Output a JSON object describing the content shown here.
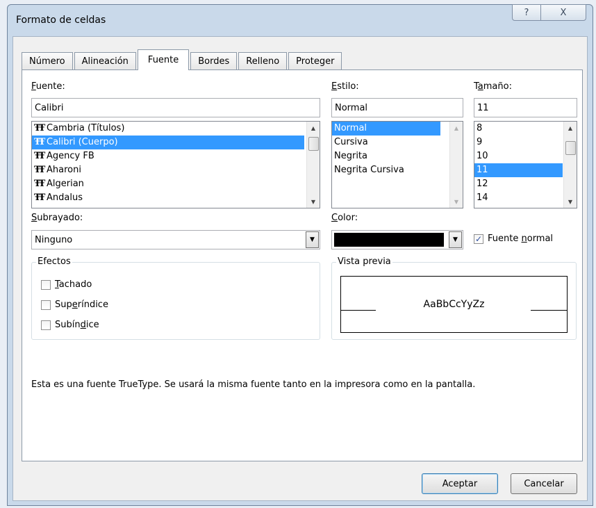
{
  "window": {
    "title": "Formato de celdas",
    "help_glyph": "?",
    "close_glyph": "X"
  },
  "tabs": [
    {
      "label": "Número"
    },
    {
      "label": "Alineación"
    },
    {
      "label": "Fuente"
    },
    {
      "label": "Bordes"
    },
    {
      "label": "Relleno"
    },
    {
      "label": "Proteger"
    }
  ],
  "font": {
    "label_underlined": "F",
    "label_rest": "uente:",
    "value": "Calibri",
    "items": [
      {
        "label": "Cambria (Títulos)",
        "selected": false
      },
      {
        "label": "Calibri (Cuerpo)",
        "selected": true
      },
      {
        "label": "Agency FB",
        "selected": false
      },
      {
        "label": "Aharoni",
        "selected": false
      },
      {
        "label": "Algerian",
        "selected": false
      },
      {
        "label": "Andalus",
        "selected": false
      }
    ]
  },
  "style": {
    "label_underlined": "E",
    "label_rest": "stilo:",
    "value": "Normal",
    "items": [
      {
        "label": "Normal",
        "selected": true
      },
      {
        "label": "Cursiva",
        "selected": false
      },
      {
        "label": "Negrita",
        "selected": false
      },
      {
        "label": "Negrita Cursiva",
        "selected": false
      }
    ]
  },
  "size": {
    "label_pre": "T",
    "label_underlined": "a",
    "label_rest": "maño:",
    "value": "11",
    "items": [
      {
        "label": "8",
        "selected": false
      },
      {
        "label": "9",
        "selected": false
      },
      {
        "label": "10",
        "selected": false
      },
      {
        "label": "11",
        "selected": true
      },
      {
        "label": "12",
        "selected": false
      },
      {
        "label": "14",
        "selected": false
      }
    ]
  },
  "underline": {
    "label_underlined": "S",
    "label_rest": "ubrayado:",
    "value": "Ninguno"
  },
  "color": {
    "label_underlined": "C",
    "label_rest": "olor:",
    "swatch": "#000000"
  },
  "normal_font": {
    "checked": true,
    "label_pre": "Fuente ",
    "label_underlined": "n",
    "label_rest": "ormal"
  },
  "effects": {
    "title": "Efectos",
    "items": [
      {
        "pre": "",
        "u": "T",
        "rest": "achado",
        "checked": false
      },
      {
        "pre": "Sup",
        "u": "e",
        "rest": "ríndice",
        "checked": false
      },
      {
        "pre": "Subín",
        "u": "d",
        "rest": "ice",
        "checked": false
      }
    ]
  },
  "preview": {
    "title": "Vista previa",
    "sample": "AaBbCcYyZz"
  },
  "info_text": "Esta es una fuente TrueType. Se usará la misma fuente tanto en la impresora como en la pantalla.",
  "buttons": {
    "ok": "Aceptar",
    "cancel": "Cancelar"
  },
  "icons": {
    "truetype": "ŦŦ",
    "arrow_up": "▲",
    "arrow_down": "▼",
    "check": "✓"
  }
}
